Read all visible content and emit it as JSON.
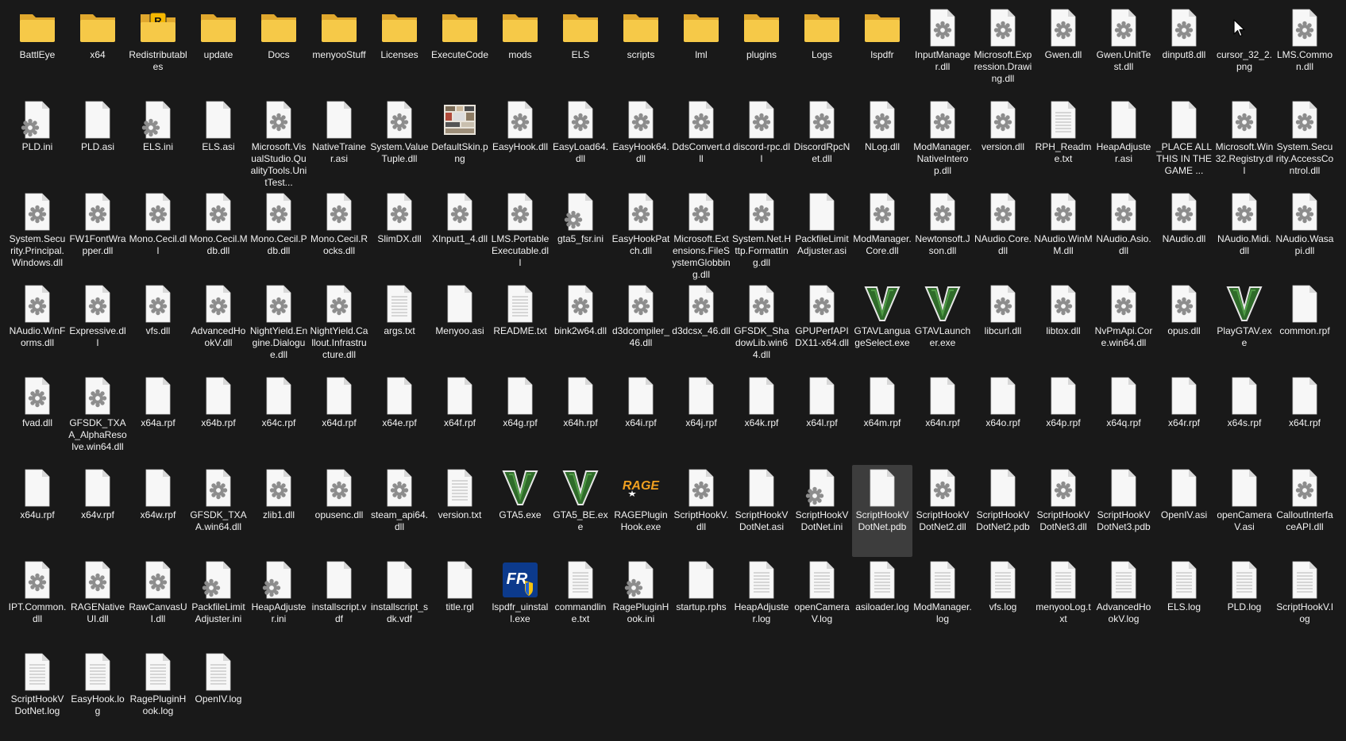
{
  "window": {
    "view": "large icons"
  },
  "colors": {
    "background": "#191919",
    "folder": "#f6c948",
    "folder_dark": "#e0a82e",
    "selection": "#3d3d3d"
  },
  "files": [
    {
      "name": "BattlEye",
      "type": "folder"
    },
    {
      "name": "x64",
      "type": "folder"
    },
    {
      "name": "Redistributables",
      "type": "folder-rockstar"
    },
    {
      "name": "update",
      "type": "folder"
    },
    {
      "name": "Docs",
      "type": "folder"
    },
    {
      "name": "menyooStuff",
      "type": "folder"
    },
    {
      "name": "Licenses",
      "type": "folder"
    },
    {
      "name": "ExecuteCode",
      "type": "folder"
    },
    {
      "name": "mods",
      "type": "folder"
    },
    {
      "name": "ELS",
      "type": "folder"
    },
    {
      "name": "scripts",
      "type": "folder"
    },
    {
      "name": "lml",
      "type": "folder"
    },
    {
      "name": "plugins",
      "type": "folder"
    },
    {
      "name": "Logs",
      "type": "folder"
    },
    {
      "name": "lspdfr",
      "type": "folder"
    },
    {
      "name": "InputManager.dll",
      "type": "dll"
    },
    {
      "name": "Microsoft.Expression.Drawing.dll",
      "type": "dll"
    },
    {
      "name": "Gwen.dll",
      "type": "dll"
    },
    {
      "name": "Gwen.UnitTest.dll",
      "type": "dll"
    },
    {
      "name": "dinput8.dll",
      "type": "dll"
    },
    {
      "name": "cursor_32_2.png",
      "type": "blank"
    },
    {
      "name": "LMS.Common.dll",
      "type": "dll"
    },
    {
      "name": "PLD.ini",
      "type": "ini"
    },
    {
      "name": "PLD.asi",
      "type": "file"
    },
    {
      "name": "ELS.ini",
      "type": "ini"
    },
    {
      "name": "ELS.asi",
      "type": "file"
    },
    {
      "name": "Microsoft.VisualStudio.QualityTools.UnitTest...",
      "type": "dll"
    },
    {
      "name": "NativeTrainer.asi",
      "type": "file"
    },
    {
      "name": "System.ValueTuple.dll",
      "type": "dll"
    },
    {
      "name": "DefaultSkin.png",
      "type": "image"
    },
    {
      "name": "EasyHook.dll",
      "type": "dll"
    },
    {
      "name": "EasyLoad64.dll",
      "type": "dll"
    },
    {
      "name": "EasyHook64.dll",
      "type": "dll"
    },
    {
      "name": "DdsConvert.dll",
      "type": "dll"
    },
    {
      "name": "discord-rpc.dll",
      "type": "dll"
    },
    {
      "name": "DiscordRpcNet.dll",
      "type": "dll"
    },
    {
      "name": "NLog.dll",
      "type": "dll"
    },
    {
      "name": "ModManager.NativeInterop.dll",
      "type": "dll"
    },
    {
      "name": "version.dll",
      "type": "dll"
    },
    {
      "name": "RPH_Readme.txt",
      "type": "text"
    },
    {
      "name": "HeapAdjuster.asi",
      "type": "file"
    },
    {
      "name": "_PLACE ALL THIS IN THE GAME ...",
      "type": "file"
    },
    {
      "name": "Microsoft.Win32.Registry.dll",
      "type": "dll"
    },
    {
      "name": "System.Security.AccessControl.dll",
      "type": "dll"
    },
    {
      "name": "System.Security.Principal.Windows.dll",
      "type": "dll"
    },
    {
      "name": "FW1FontWrapper.dll",
      "type": "dll"
    },
    {
      "name": "Mono.Cecil.dll",
      "type": "dll"
    },
    {
      "name": "Mono.Cecil.Mdb.dll",
      "type": "dll"
    },
    {
      "name": "Mono.Cecil.Pdb.dll",
      "type": "dll"
    },
    {
      "name": "Mono.Cecil.Rocks.dll",
      "type": "dll"
    },
    {
      "name": "SlimDX.dll",
      "type": "dll"
    },
    {
      "name": "XInput1_4.dll",
      "type": "dll"
    },
    {
      "name": "LMS.PortableExecutable.dll",
      "type": "dll"
    },
    {
      "name": "gta5_fsr.ini",
      "type": "ini"
    },
    {
      "name": "EasyHookPatch.dll",
      "type": "dll"
    },
    {
      "name": "Microsoft.Extensions.FileSystemGlobbing.dll",
      "type": "dll"
    },
    {
      "name": "System.Net.Http.Formatting.dll",
      "type": "dll"
    },
    {
      "name": "PackfileLimitAdjuster.asi",
      "type": "file"
    },
    {
      "name": "ModManager.Core.dll",
      "type": "dll"
    },
    {
      "name": "Newtonsoft.Json.dll",
      "type": "dll"
    },
    {
      "name": "NAudio.Core.dll",
      "type": "dll"
    },
    {
      "name": "NAudio.WinMM.dll",
      "type": "dll"
    },
    {
      "name": "NAudio.Asio.dll",
      "type": "dll"
    },
    {
      "name": "NAudio.dll",
      "type": "dll"
    },
    {
      "name": "NAudio.Midi.dll",
      "type": "dll"
    },
    {
      "name": "NAudio.Wasapi.dll",
      "type": "dll"
    },
    {
      "name": "NAudio.WinForms.dll",
      "type": "dll"
    },
    {
      "name": "Expressive.dll",
      "type": "dll"
    },
    {
      "name": "vfs.dll",
      "type": "dll"
    },
    {
      "name": "AdvancedHookV.dll",
      "type": "dll"
    },
    {
      "name": "NightYield.Engine.Dialogue.dll",
      "type": "dll"
    },
    {
      "name": "NightYield.Callout.Infrastructure.dll",
      "type": "dll"
    },
    {
      "name": "args.txt",
      "type": "text"
    },
    {
      "name": "Menyoo.asi",
      "type": "file"
    },
    {
      "name": "README.txt",
      "type": "text"
    },
    {
      "name": "bink2w64.dll",
      "type": "dll"
    },
    {
      "name": "d3dcompiler_46.dll",
      "type": "dll"
    },
    {
      "name": "d3dcsx_46.dll",
      "type": "dll"
    },
    {
      "name": "GFSDK_ShadowLib.win64.dll",
      "type": "dll"
    },
    {
      "name": "GPUPerfAPIDX11-x64.dll",
      "type": "dll"
    },
    {
      "name": "GTAVLanguageSelect.exe",
      "type": "gta"
    },
    {
      "name": "GTAVLauncher.exe",
      "type": "gta"
    },
    {
      "name": "libcurl.dll",
      "type": "dll"
    },
    {
      "name": "libtox.dll",
      "type": "dll"
    },
    {
      "name": "NvPmApi.Core.win64.dll",
      "type": "dll"
    },
    {
      "name": "opus.dll",
      "type": "dll"
    },
    {
      "name": "PlayGTAV.exe",
      "type": "gta"
    },
    {
      "name": "common.rpf",
      "type": "file"
    },
    {
      "name": "fvad.dll",
      "type": "dll"
    },
    {
      "name": "GFSDK_TXAA_AlphaResolve.win64.dll",
      "type": "dll"
    },
    {
      "name": "x64a.rpf",
      "type": "file"
    },
    {
      "name": "x64b.rpf",
      "type": "file"
    },
    {
      "name": "x64c.rpf",
      "type": "file"
    },
    {
      "name": "x64d.rpf",
      "type": "file"
    },
    {
      "name": "x64e.rpf",
      "type": "file"
    },
    {
      "name": "x64f.rpf",
      "type": "file"
    },
    {
      "name": "x64g.rpf",
      "type": "file"
    },
    {
      "name": "x64h.rpf",
      "type": "file"
    },
    {
      "name": "x64i.rpf",
      "type": "file"
    },
    {
      "name": "x64j.rpf",
      "type": "file"
    },
    {
      "name": "x64k.rpf",
      "type": "file"
    },
    {
      "name": "x64l.rpf",
      "type": "file"
    },
    {
      "name": "x64m.rpf",
      "type": "file"
    },
    {
      "name": "x64n.rpf",
      "type": "file"
    },
    {
      "name": "x64o.rpf",
      "type": "file"
    },
    {
      "name": "x64p.rpf",
      "type": "file"
    },
    {
      "name": "x64q.rpf",
      "type": "file"
    },
    {
      "name": "x64r.rpf",
      "type": "file"
    },
    {
      "name": "x64s.rpf",
      "type": "file"
    },
    {
      "name": "x64t.rpf",
      "type": "file"
    },
    {
      "name": "x64u.rpf",
      "type": "file"
    },
    {
      "name": "x64v.rpf",
      "type": "file"
    },
    {
      "name": "x64w.rpf",
      "type": "file"
    },
    {
      "name": "GFSDK_TXAA.win64.dll",
      "type": "dll"
    },
    {
      "name": "zlib1.dll",
      "type": "dll"
    },
    {
      "name": "opusenc.dll",
      "type": "dll"
    },
    {
      "name": "steam_api64.dll",
      "type": "dll"
    },
    {
      "name": "version.txt",
      "type": "text"
    },
    {
      "name": "GTA5.exe",
      "type": "gta"
    },
    {
      "name": "GTA5_BE.exe",
      "type": "gta"
    },
    {
      "name": "RAGEPluginHook.exe",
      "type": "rage"
    },
    {
      "name": "ScriptHookV.dll",
      "type": "dll"
    },
    {
      "name": "ScriptHookVDotNet.asi",
      "type": "file"
    },
    {
      "name": "ScriptHookVDotNet.ini",
      "type": "ini"
    },
    {
      "name": "ScriptHookVDotNet.pdb",
      "type": "file",
      "selected": true
    },
    {
      "name": "ScriptHookVDotNet2.dll",
      "type": "dll"
    },
    {
      "name": "ScriptHookVDotNet2.pdb",
      "type": "file"
    },
    {
      "name": "ScriptHookVDotNet3.dll",
      "type": "dll"
    },
    {
      "name": "ScriptHookVDotNet3.pdb",
      "type": "file"
    },
    {
      "name": "OpenIV.asi",
      "type": "file"
    },
    {
      "name": "openCameraV.asi",
      "type": "file"
    },
    {
      "name": "CalloutInterfaceAPI.dll",
      "type": "dll"
    },
    {
      "name": "IPT.Common.dll",
      "type": "dll"
    },
    {
      "name": "RAGENativeUI.dll",
      "type": "dll"
    },
    {
      "name": "RawCanvasUI.dll",
      "type": "dll"
    },
    {
      "name": "PackfileLimitAdjuster.ini",
      "type": "ini"
    },
    {
      "name": "HeapAdjuster.ini",
      "type": "ini"
    },
    {
      "name": "installscript.vdf",
      "type": "file"
    },
    {
      "name": "installscript_sdk.vdf",
      "type": "file"
    },
    {
      "name": "title.rgl",
      "type": "file"
    },
    {
      "name": "lspdfr_uinstall.exe",
      "type": "lspdfr"
    },
    {
      "name": "commandline.txt",
      "type": "text"
    },
    {
      "name": "RagePluginHook.ini",
      "type": "ini"
    },
    {
      "name": "startup.rphs",
      "type": "file"
    },
    {
      "name": "HeapAdjuster.log",
      "type": "text"
    },
    {
      "name": "openCameraV.log",
      "type": "text"
    },
    {
      "name": "asiloader.log",
      "type": "text"
    },
    {
      "name": "ModManager.log",
      "type": "text"
    },
    {
      "name": "vfs.log",
      "type": "text"
    },
    {
      "name": "menyooLog.txt",
      "type": "text"
    },
    {
      "name": "AdvancedHookV.log",
      "type": "text"
    },
    {
      "name": "ELS.log",
      "type": "text"
    },
    {
      "name": "PLD.log",
      "type": "text"
    },
    {
      "name": "ScriptHookV.log",
      "type": "text"
    },
    {
      "name": "ScriptHookVDotNet.log",
      "type": "text"
    },
    {
      "name": "EasyHook.log",
      "type": "text"
    },
    {
      "name": "RagePluginHook.log",
      "type": "text"
    },
    {
      "name": "OpenIV.log",
      "type": "text"
    }
  ]
}
